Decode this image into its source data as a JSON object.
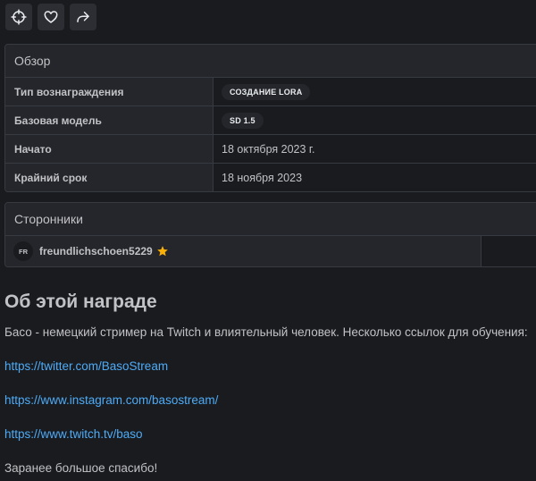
{
  "actions": {
    "locate_icon": "crosshair-icon",
    "like_icon": "heart-icon",
    "share_icon": "share-icon"
  },
  "overview": {
    "title": "Обзор",
    "rows": [
      {
        "label": "Тип вознаграждения",
        "value": "СОЗДАНИЕ LORA",
        "badge": true
      },
      {
        "label": "Базовая модель",
        "value": "SD 1.5",
        "badge": true
      },
      {
        "label": "Начато",
        "value": "18 октября 2023 г."
      },
      {
        "label": "Крайний срок",
        "value": "18 ноября 2023"
      }
    ]
  },
  "supporters": {
    "title": "Сторонники",
    "items": [
      {
        "initials": "FR",
        "name": "freundlichschoen5229",
        "icon": "star-icon"
      }
    ]
  },
  "about": {
    "title": "Об этой награде",
    "description": "Басо - немецкий стример на Twitch и влиятельный человек. Несколько ссылок для обучения:",
    "links": [
      "https://twitter.com/BasoStream",
      "https://www.instagram.com/basostream/",
      "https://www.twitch.tv/baso"
    ],
    "thanks": "Заранее большое спасибо!"
  },
  "colors": {
    "background": "#1a1b1e",
    "panel_header": "#25262b",
    "border": "#373a40",
    "link": "#4dabf7",
    "star": "#fab005"
  }
}
